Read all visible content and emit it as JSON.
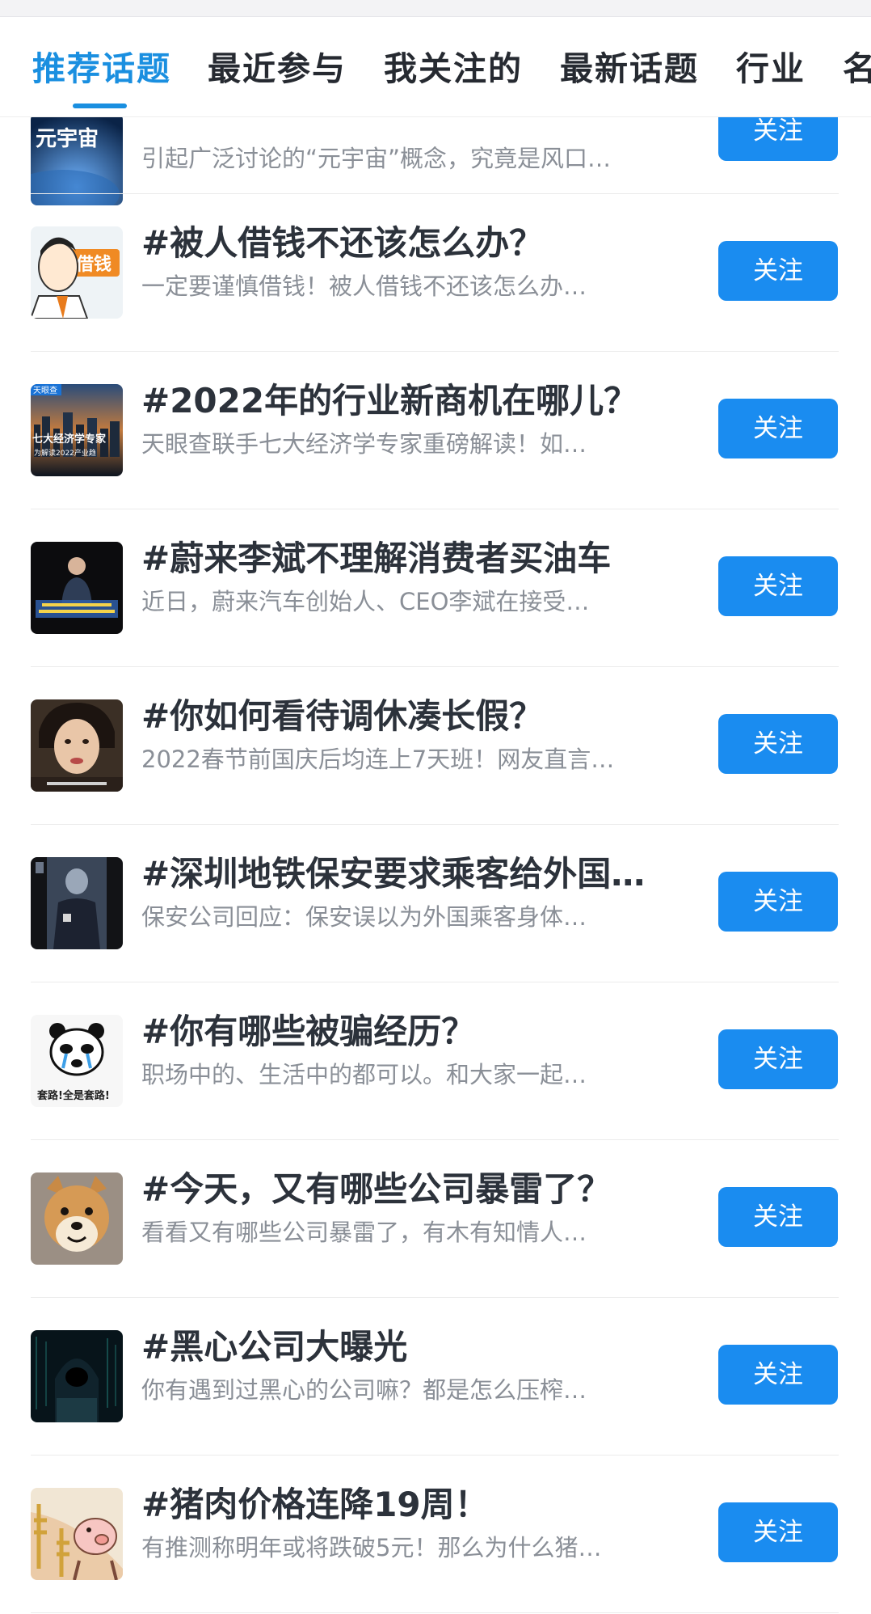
{
  "tabs": [
    "推荐话题",
    "最近参与",
    "我关注的",
    "最新话题",
    "行业",
    "名"
  ],
  "accent_color": "#1a8fe0",
  "button_color": "#1a8cf0",
  "topics": [
    {
      "title": "",
      "desc": "引起广泛讨论的“元宇宙”概念，究竟是风口…",
      "follow": "关注",
      "thumb_text": "元宇宙",
      "icon": "metaverse-thumbnail"
    },
    {
      "title": "#被人借钱不还该怎么办？",
      "desc": "一定要谨慎借钱！被人借钱不还该怎么办…",
      "follow": "关注",
      "thumb_text": "借钱",
      "icon": "cartoon-man-thumbnail"
    },
    {
      "title": "#2022年的行业新商机在哪儿？",
      "desc": "天眼查联手七大经济学专家重磅解读！如…",
      "follow": "关注",
      "thumb_text": "七大经济学专家",
      "thumb_text2": "为解读2022产业趋",
      "thumb_text3": "天眼查",
      "icon": "city-skyline-thumbnail"
    },
    {
      "title": "#蔚来李斌不理解消费者买油车",
      "desc": "近日，蔚来汽车创始人、CEO李斌在接受…",
      "follow": "关注",
      "icon": "speaker-stage-thumbnail"
    },
    {
      "title": "#你如何看待调休凑长假？",
      "desc": "2022春节前国庆后均连上7天班！网友直言…",
      "follow": "关注",
      "icon": "drama-woman-thumbnail"
    },
    {
      "title": "#深圳地铁保安要求乘客给外国…",
      "desc": "保安公司回应：保安误以为外国乘客身体…",
      "follow": "关注",
      "icon": "subway-guard-thumbnail"
    },
    {
      "title": "#你有哪些被骗经历？",
      "desc": "职场中的、生活中的都可以。和大家一起…",
      "follow": "关注",
      "thumb_text": "套路!全是套路!",
      "icon": "crying-panda-meme-thumbnail"
    },
    {
      "title": "#今天，又有哪些公司暴雷了？",
      "desc": "看看又有哪些公司暴雷了，有木有知情人…",
      "follow": "关注",
      "icon": "shiba-dog-thumbnail"
    },
    {
      "title": "#黑心公司大曝光",
      "desc": "你有遇到过黑心的公司嘛？都是怎么压榨…",
      "follow": "关注",
      "icon": "hacker-thumbnail"
    },
    {
      "title": "#猪肉价格连降19周！",
      "desc": "有推测称明年或将跌破5元！那么为什么猪…",
      "follow": "关注",
      "icon": "pig-cartoon-thumbnail"
    }
  ]
}
